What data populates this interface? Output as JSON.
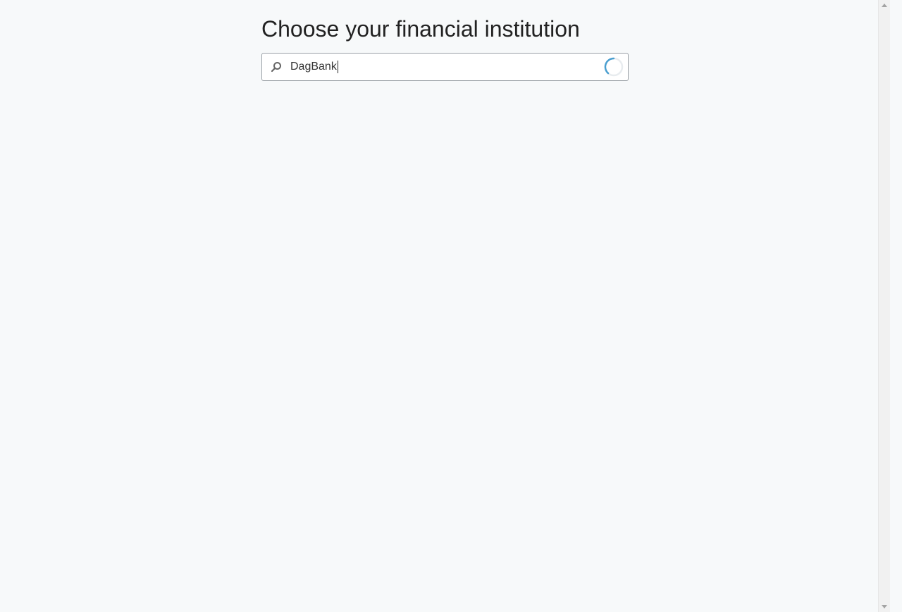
{
  "page": {
    "title": "Choose your financial institution"
  },
  "search": {
    "value": "DagBank",
    "icon": "search-icon",
    "status": "loading"
  },
  "colors": {
    "background": "#f7f9fa",
    "spinner_accent": "#4a9fd0"
  }
}
